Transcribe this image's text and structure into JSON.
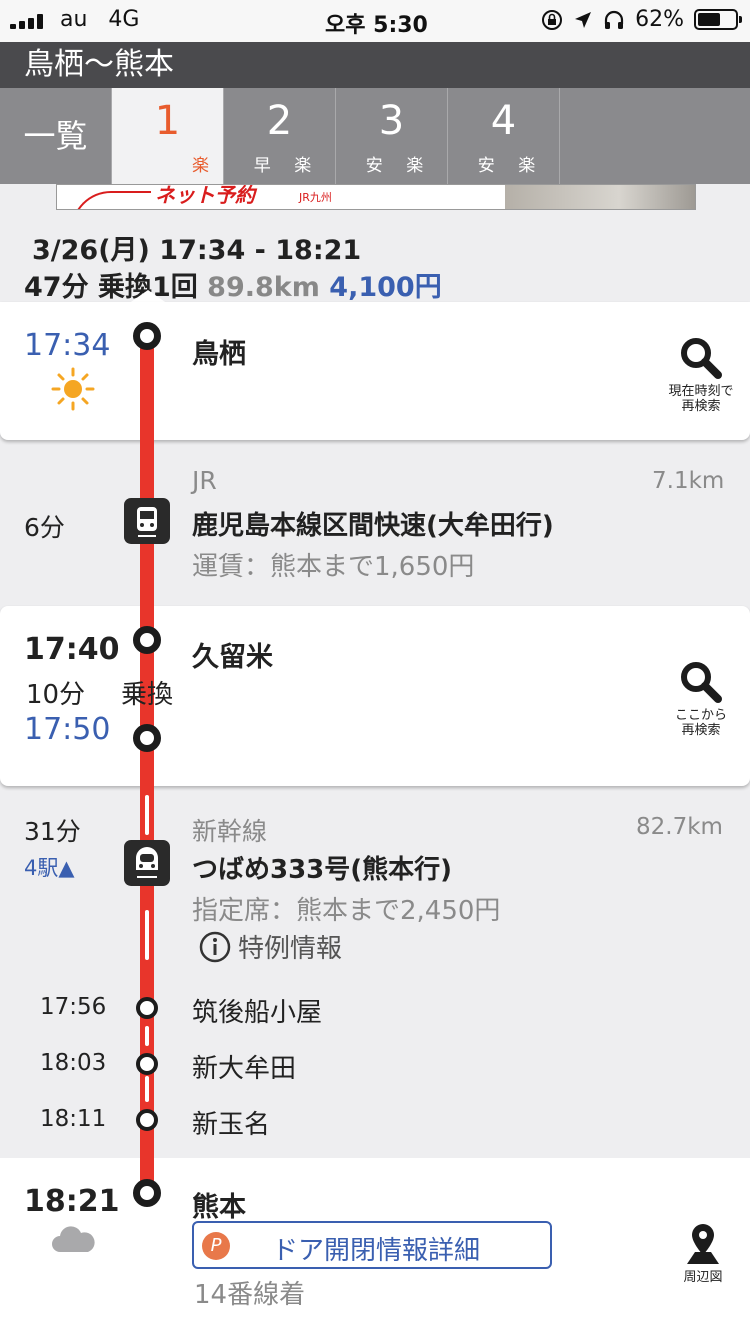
{
  "status_bar": {
    "carrier": "au",
    "network": "4G",
    "time": "오후 5:30",
    "battery": "62%",
    "battery_level": 0.62
  },
  "title": "鳥栖～熊本",
  "tabs": [
    {
      "label": "一覧"
    },
    {
      "num": "1",
      "tags": [
        "楽"
      ]
    },
    {
      "num": "2",
      "tags": [
        "早",
        "楽"
      ]
    },
    {
      "num": "3",
      "tags": [
        "安",
        "楽"
      ]
    },
    {
      "num": "4",
      "tags": [
        "安",
        "楽"
      ]
    }
  ],
  "ad": {
    "text": "ネット予約",
    "sub": "JR九州"
  },
  "summary": {
    "date_time": "3/26(月) 17:34 - 18:21",
    "duration_transfer": "47分 乗換1回",
    "distance": "89.8km",
    "fare": "4,100円"
  },
  "stops": {
    "tosu": {
      "time": "17:34",
      "name": "鳥栖",
      "weather": "sunny-icon",
      "search_label_1": "現在時刻で",
      "search_label_2": "再検索"
    },
    "kurume": {
      "arr": "17:40",
      "wait": "10分",
      "transfer": "乗換",
      "dep": "17:50",
      "name": "久留米",
      "search_label_1": "ここから",
      "search_label_2": "再検索"
    },
    "kumamoto": {
      "time": "18:21",
      "name": "熊本",
      "weather": "cloud-icon",
      "door_info": "ドア開閉情報詳細",
      "door_p": "P",
      "track": "14番線着",
      "map_label": "周辺図"
    }
  },
  "segments": [
    {
      "company": "JR",
      "distance": "7.1km",
      "duration": "6分",
      "line": "鹿児島本線区間快速(大牟田行)",
      "fare": "運賃：熊本まで1,650円"
    },
    {
      "company": "新幹線",
      "distance": "82.7km",
      "duration": "31分",
      "stations_toggle": "4駅▲",
      "line": "つばめ333号(熊本行)",
      "fare": "指定席：熊本まで2,450円",
      "info": "特例情報"
    }
  ],
  "intermediate": [
    {
      "time": "17:56",
      "name": "筑後船小屋"
    },
    {
      "time": "18:03",
      "name": "新大牟田"
    },
    {
      "time": "18:11",
      "name": "新玉名"
    }
  ]
}
